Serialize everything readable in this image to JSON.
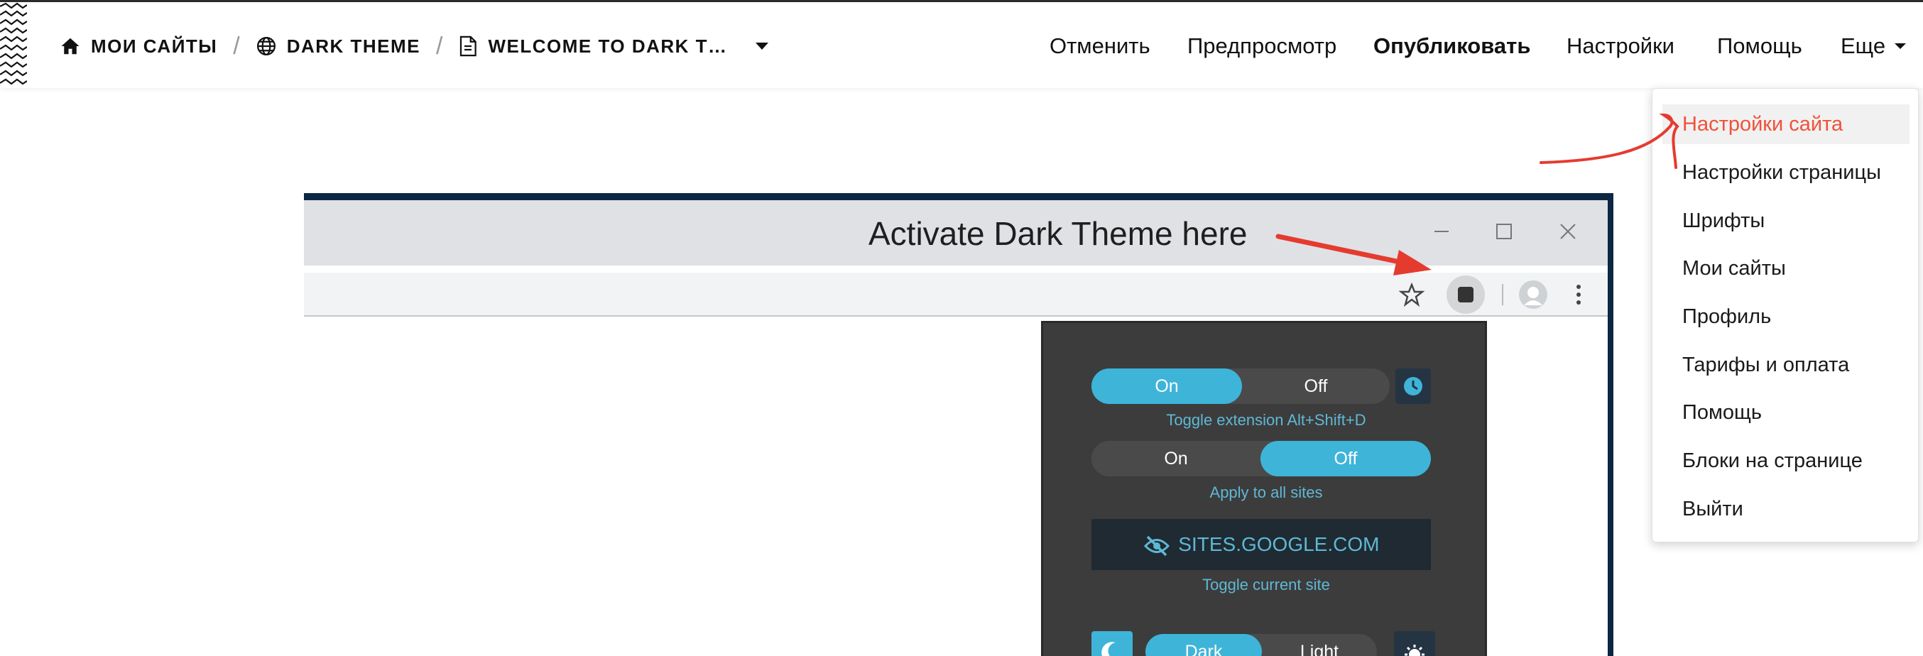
{
  "breadcrumb": {
    "home": "МОИ САЙТЫ",
    "site": "DARK THEME",
    "page": "WELCOME TO DARK T…"
  },
  "nav": {
    "cancel": "Отменить",
    "preview": "Предпросмотр",
    "publish": "Опубликовать",
    "settings": "Настройки",
    "help": "Помощь",
    "more": "Еще"
  },
  "menu": {
    "items": [
      "Настройки сайта",
      "Настройки страницы",
      "Шрифты",
      "Мои сайты",
      "Профиль",
      "Тарифы и оплата",
      "Помощь",
      "Блоки на странице",
      "Выйти"
    ]
  },
  "screenshot": {
    "annotation": "Activate Dark Theme here",
    "popup": {
      "toggle1_on": "On",
      "toggle1_off": "Off",
      "toggle1_hint": "Toggle extension Alt+Shift+D",
      "toggle2_on": "On",
      "toggle2_off": "Off",
      "toggle2_hint": "Apply to all sites",
      "site": "SITES.GOOGLE.COM",
      "site_hint": "Toggle current site",
      "theme_dark": "Dark",
      "theme_light": "Light"
    }
  },
  "colors": {
    "accent": "#f0523a",
    "extension_blue": "#3eb4d9",
    "annotation_arrow": "#e53b2f"
  },
  "icons": [
    "home-icon",
    "globe-icon",
    "page-icon",
    "chevron-down-icon",
    "clock-icon",
    "eye-slash-icon",
    "moon-icon",
    "sun-icon",
    "star-icon"
  ]
}
